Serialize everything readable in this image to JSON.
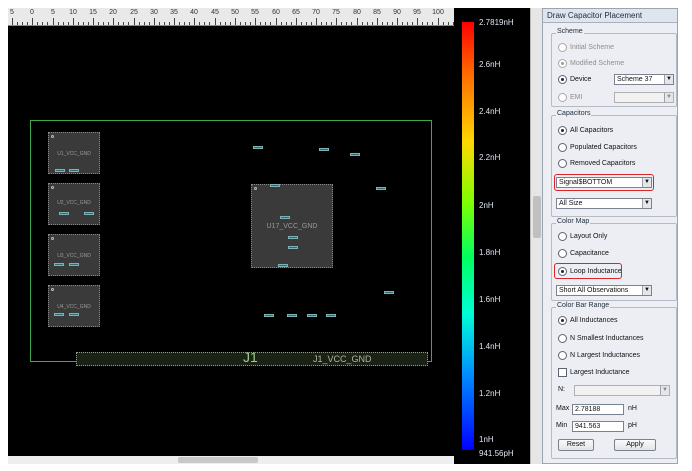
{
  "ruler": {
    "labels": [
      "5",
      "0",
      "5",
      "10",
      "15",
      "20",
      "25",
      "30",
      "35",
      "40",
      "45",
      "50",
      "55",
      "60",
      "65",
      "70",
      "75",
      "80",
      "85",
      "90",
      "95",
      "100"
    ]
  },
  "canvas": {
    "chips": [
      {
        "label": "U1_VCC_GND"
      },
      {
        "label": "U2_VCC_GND"
      },
      {
        "label": "U3_VCC_GND"
      },
      {
        "label": "U4_VCC_GND"
      },
      {
        "label": "U17_VCC_GND"
      }
    ],
    "connector": {
      "title": "J1",
      "name": "J1_VCC_GND"
    },
    "colors": {
      "board_outline": "#3fa84a",
      "background": "#000000"
    }
  },
  "colorbar": {
    "labels": [
      "2.7819nH",
      "2.6nH",
      "2.4nH",
      "2.2nH",
      "2nH",
      "1.8nH",
      "1.6nH",
      "1.4nH",
      "1.2nH",
      "1nH",
      "941.56pH"
    ]
  },
  "panel": {
    "title": "Draw Capacitor Placement",
    "scheme": {
      "title": "Scheme",
      "initial": "Initial Scheme",
      "modified": "Modified Scheme",
      "device": "Device",
      "device_value": "Scheme 37",
      "emi": "EMI",
      "emi_value": ""
    },
    "capacitors": {
      "title": "Capacitors",
      "all": "All Capacitors",
      "populated": "Populated Capacitors",
      "removed": "Removed Capacitors",
      "layer_value": "Signal$BOTTOM",
      "size_value": "All Size"
    },
    "color_map": {
      "title": "Color Map",
      "layout_only": "Layout Only",
      "capacitance": "Capacitance",
      "loop_inductance": "Loop Inductance",
      "observation_value": "Short All Observations"
    },
    "range": {
      "title": "Color Bar Range",
      "all": "All Inductances",
      "n_smallest": "N Smallest Inductances",
      "n_largest": "N Largest Inductances",
      "largest": "Largest Inductance",
      "n_label": "N:",
      "n_value": "",
      "max_label": "Max",
      "max_value": "2.78188",
      "max_unit": "nH",
      "min_label": "Min",
      "min_value": "941.563",
      "min_unit": "pH"
    },
    "buttons": {
      "reset": "Reset",
      "apply": "Apply"
    },
    "highlight_color": "#d8262a"
  }
}
